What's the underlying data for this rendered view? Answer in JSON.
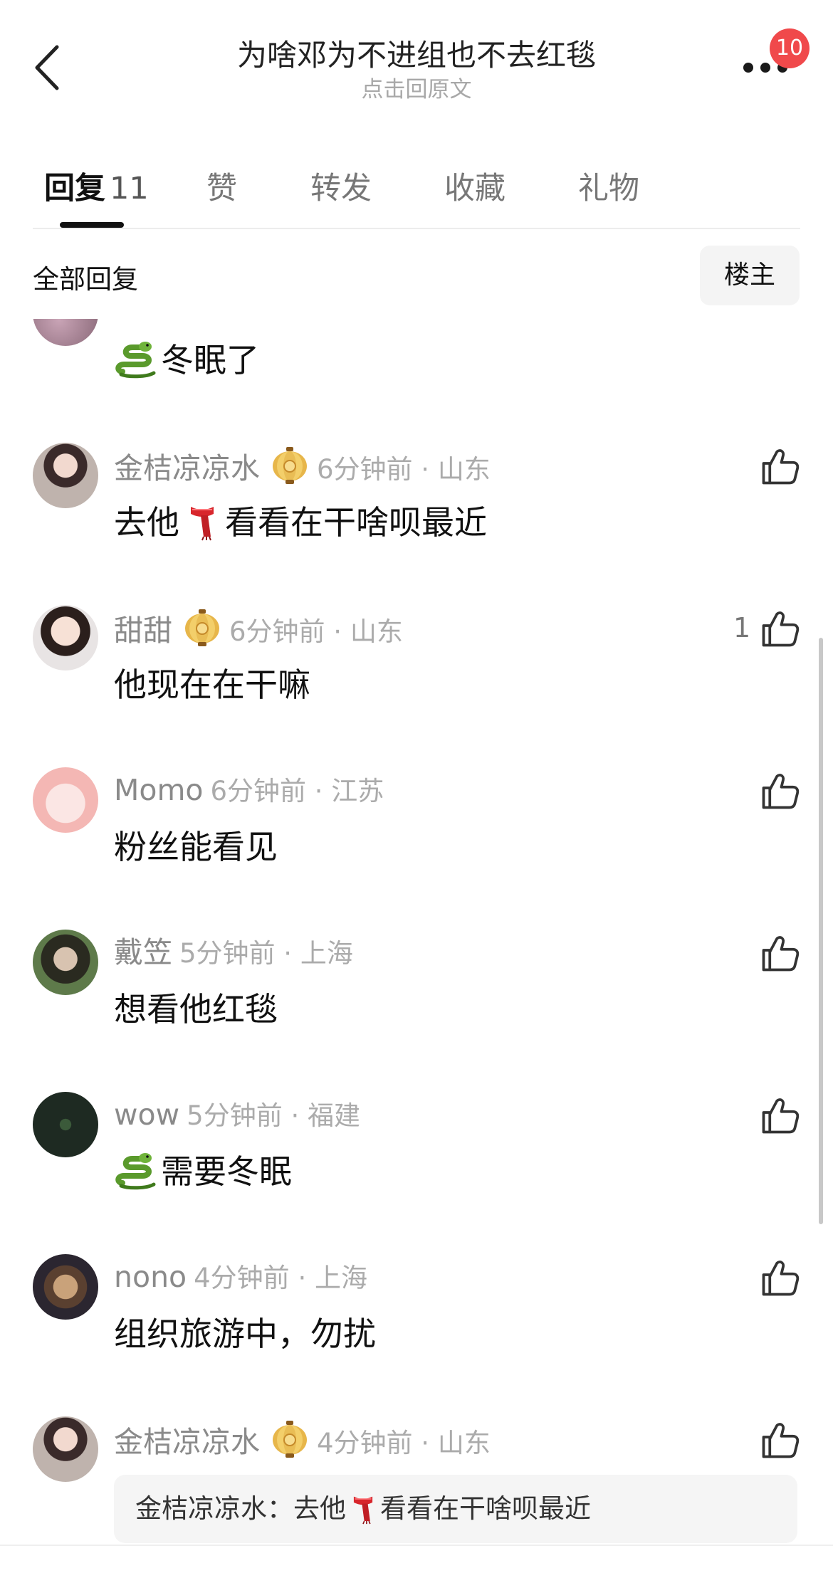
{
  "header": {
    "title": "为啥邓为不进组也不去红毯",
    "subtitle": "点击回原文",
    "notification_count": "10"
  },
  "tabs": [
    {
      "label": "回复",
      "count": "11",
      "active": true
    },
    {
      "label": "赞"
    },
    {
      "label": "转发"
    },
    {
      "label": "收藏"
    },
    {
      "label": "礼物"
    }
  ],
  "section": {
    "title": "全部回复",
    "filter_label": "楼主"
  },
  "partial_comment": {
    "text": "冬眠了",
    "emoji": "snake"
  },
  "comments": [
    {
      "name": "金桔凉凉水",
      "badge": "lantern",
      "time": "6分钟前 · 山东",
      "text_before": "去他",
      "emoji": "scarf",
      "text_after": "看看在干啥呗最近",
      "likes": ""
    },
    {
      "name": "甜甜",
      "badge": "lantern",
      "time": "6分钟前 · 山东",
      "text": "他现在在干嘛",
      "likes": "1"
    },
    {
      "name": "Momo",
      "time": "6分钟前 · 江苏",
      "text": "粉丝能看见",
      "likes": ""
    },
    {
      "name": "戴笠",
      "time": "5分钟前 · 上海",
      "text": "想看他红毯",
      "likes": ""
    },
    {
      "name": "wow",
      "time": "5分钟前 · 福建",
      "text": "需要冬眠",
      "emoji": "snake",
      "likes": ""
    },
    {
      "name": "nono",
      "time": "4分钟前 · 上海",
      "text": "组织旅游中，勿扰",
      "likes": ""
    },
    {
      "name": "金桔凉凉水",
      "badge": "lantern",
      "time": "4分钟前 · 山东",
      "quote_name": "金桔凉凉水：",
      "quote_before": "去他",
      "quote_emoji": "scarf",
      "quote_after": "看看在干啥呗最近",
      "likes": ""
    }
  ],
  "colors": {
    "badge_red": "#f0494b",
    "name_gray": "#8a8a8a",
    "time_gray": "#ababab"
  }
}
